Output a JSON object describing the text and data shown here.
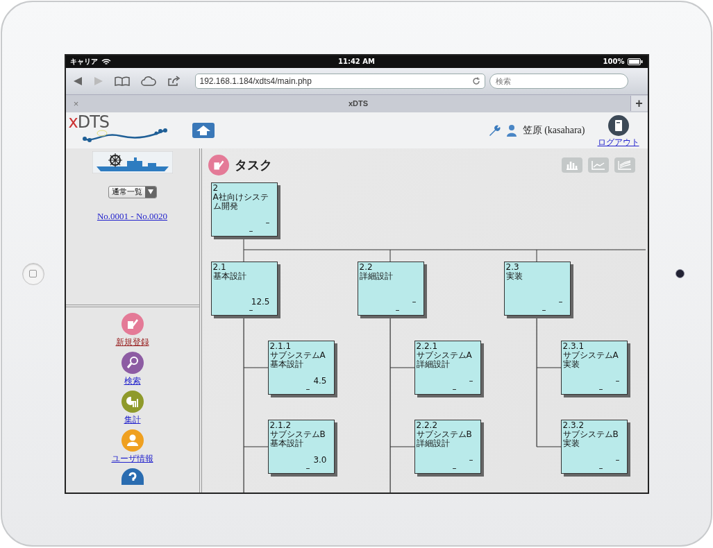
{
  "status_bar": {
    "carrier": "キャリア",
    "time": "11:42 AM",
    "battery": "100%"
  },
  "browser": {
    "url": "192.168.1.184/xdts4/main.php",
    "search": {
      "placeholder": "検索"
    },
    "tab": {
      "close": "×",
      "title": "xDTS"
    },
    "new_tab": "+"
  },
  "header": {
    "logo": {
      "mark": "x",
      "rest": "DTS"
    },
    "user": "笠原 (kasahara)",
    "logout": "ログアウト"
  },
  "sidebar": {
    "view_select": {
      "value": "通常一覧"
    },
    "range_link": "No.0001 - No.0020",
    "menu": [
      {
        "label": "新規登録",
        "color": "#e47a97",
        "visited": true
      },
      {
        "label": "検索",
        "color": "#8d5ca3",
        "visited": false
      },
      {
        "label": "集計",
        "color": "#8f9a2b",
        "visited": false
      },
      {
        "label": "ユーザ情報",
        "color": "#efa020",
        "visited": false
      }
    ]
  },
  "main": {
    "title": "タスク",
    "tree": {
      "number": "2",
      "lines": [
        "A社向けシステム開発"
      ],
      "values": [
        "–",
        "–"
      ],
      "children": [
        {
          "number": "2.1",
          "lines": [
            "基本設計"
          ],
          "values": [
            "12.5",
            "–"
          ],
          "more_below": true,
          "children": [
            {
              "number": "2.1.1",
              "lines": [
                "サブシステムA",
                "基本設計"
              ],
              "values": [
                "4.5",
                "–"
              ]
            },
            {
              "number": "2.1.2",
              "lines": [
                "サブシステムB",
                "基本設計"
              ],
              "values": [
                "3.0",
                "–"
              ]
            }
          ]
        },
        {
          "number": "2.2",
          "lines": [
            "詳細設計"
          ],
          "values": [
            "–",
            "–"
          ],
          "more_below": true,
          "children": [
            {
              "number": "2.2.1",
              "lines": [
                "サブシステムA",
                "詳細設計"
              ],
              "values": [
                "–",
                "–"
              ]
            },
            {
              "number": "2.2.2",
              "lines": [
                "サブシステムB",
                "詳細設計"
              ],
              "values": [
                "–",
                "–"
              ]
            }
          ]
        },
        {
          "number": "2.3",
          "lines": [
            "実装"
          ],
          "values": [
            "–",
            "–"
          ],
          "more_below": false,
          "children": [
            {
              "number": "2.3.1",
              "lines": [
                "サブシステムA",
                "実装"
              ],
              "values": [
                "–",
                "–"
              ]
            },
            {
              "number": "2.3.2",
              "lines": [
                "サブシステムB",
                "実装"
              ],
              "values": [
                "–",
                "–"
              ]
            }
          ]
        }
      ]
    }
  }
}
